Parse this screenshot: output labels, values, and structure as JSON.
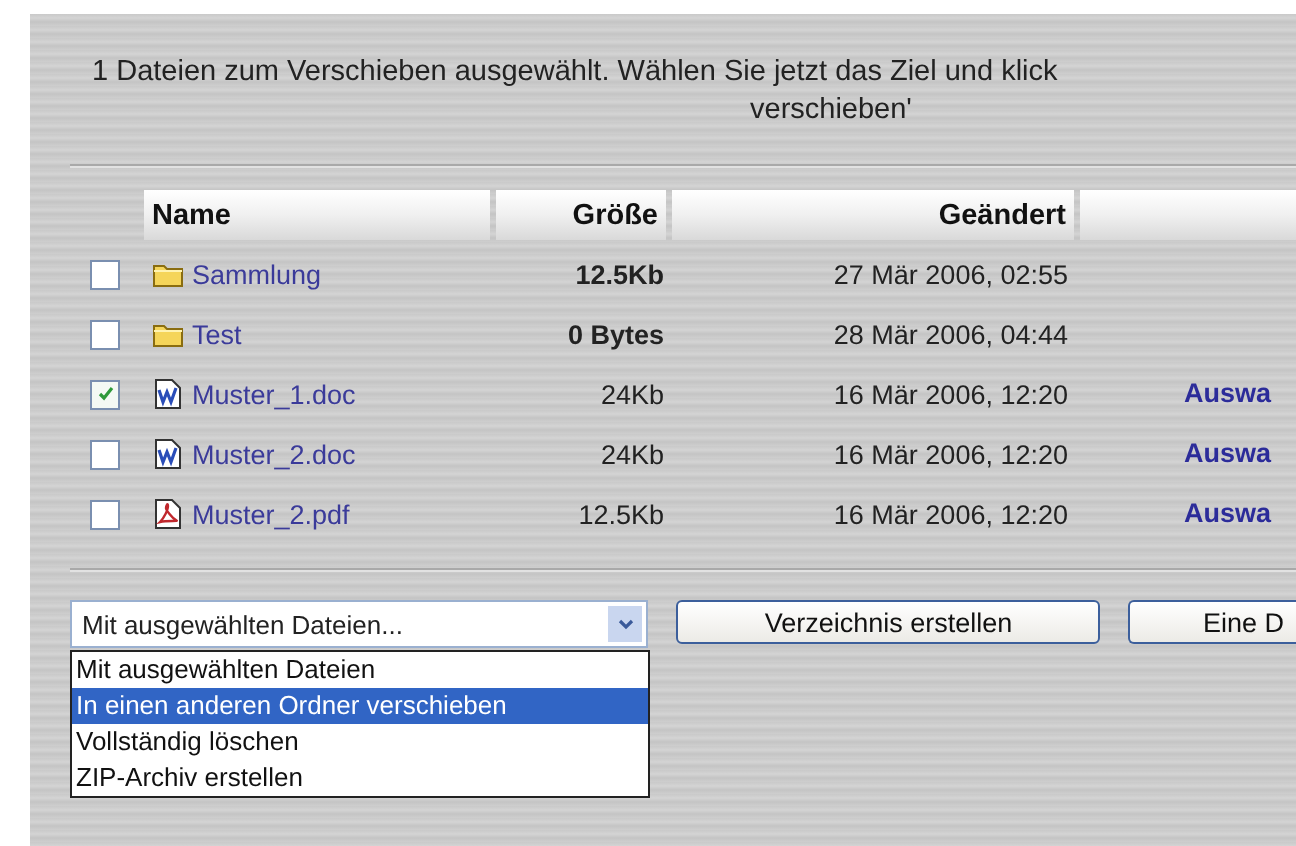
{
  "message": {
    "line_1": "1 Dateien zum Verschieben ausgewählt. Wählen Sie jetzt das Ziel und klick",
    "line_2": "verschieben'"
  },
  "table": {
    "columns": [
      "Name",
      "Größe",
      "Geändert"
    ],
    "rows": [
      {
        "kind": "folder",
        "checked": false,
        "name": "Sammlung",
        "size": "12.5Kb",
        "modified": "27 Mär 2006, 02:55"
      },
      {
        "kind": "folder",
        "checked": false,
        "name": "Test",
        "size": "0 Bytes",
        "modified": "28 Mär 2006, 04:44"
      },
      {
        "kind": "doc",
        "checked": true,
        "name": "Muster_1.doc",
        "size": "24Kb",
        "modified": "16 Mär 2006, 12:20",
        "action": "Auswa"
      },
      {
        "kind": "doc",
        "checked": false,
        "name": "Muster_2.doc",
        "size": "24Kb",
        "modified": "16 Mär 2006, 12:20",
        "action": "Auswa"
      },
      {
        "kind": "pdf",
        "checked": false,
        "name": "Muster_2.pdf",
        "size": "12.5Kb",
        "modified": "16 Mär 2006, 12:20",
        "action": "Auswa"
      }
    ]
  },
  "action_select": {
    "value": "Mit ausgewählten Dateien...",
    "options": [
      {
        "label": "Mit ausgewählten Dateien",
        "selected": false
      },
      {
        "label": "In einen anderen Ordner verschieben",
        "selected": true
      },
      {
        "label": "Vollständig löschen",
        "selected": false
      },
      {
        "label": "ZIP-Archiv erstellen",
        "selected": false
      }
    ]
  },
  "buttons": [
    "Verzeichnis erstellen",
    "Eine D"
  ]
}
